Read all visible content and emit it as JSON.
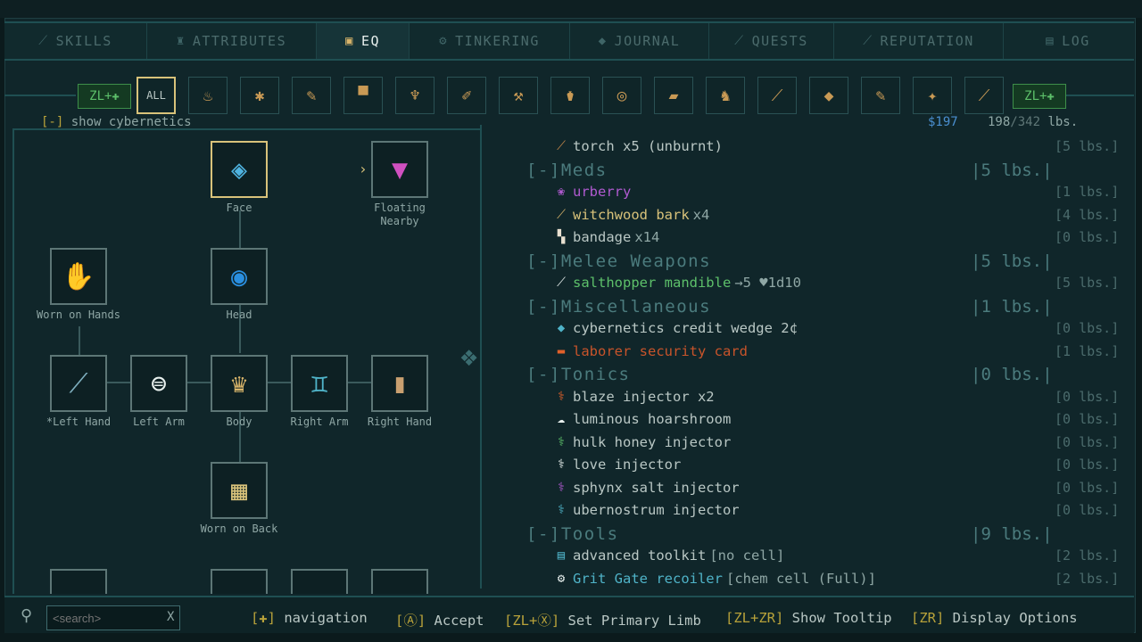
{
  "tabs": [
    {
      "label": "SKILLS",
      "icon": "skills-icon",
      "glyph": "⟋"
    },
    {
      "label": "ATTRIBUTES",
      "icon": "attributes-icon",
      "glyph": "♜"
    },
    {
      "label": "EQ",
      "icon": "eq-icon",
      "glyph": "▣"
    },
    {
      "label": "TINKERING",
      "icon": "tinkering-icon",
      "glyph": "⚙"
    },
    {
      "label": "JOURNAL",
      "icon": "journal-icon",
      "glyph": "◆"
    },
    {
      "label": "QUESTS",
      "icon": "quests-icon",
      "glyph": "⟋"
    },
    {
      "label": "REPUTATION",
      "icon": "reputation-icon",
      "glyph": "⟋"
    },
    {
      "label": "LOG",
      "icon": "log-icon",
      "glyph": "▤"
    }
  ],
  "filters": {
    "zl_left": "ZL+✚",
    "zl_right": "ZL+✚",
    "all_label": "ALL",
    "icons": [
      "♨",
      "✱",
      "✎",
      "▀",
      "♆",
      "✐",
      "⚒",
      "⚱",
      "◎",
      "▰",
      "♞",
      "⟋",
      "◆",
      "✎",
      "✦",
      "⟋"
    ]
  },
  "show_cybernetics": {
    "bracket": "[-]",
    "label": "show cybernetics"
  },
  "money": "$197",
  "weight": {
    "current": "198",
    "max": "/342",
    "unit": "lbs."
  },
  "body_slots": [
    {
      "label": "Face",
      "glyph": "◈",
      "color": "#4fb3e0"
    },
    {
      "label": "Floating Nearby",
      "glyph": "▼",
      "color": "#d050c0"
    },
    {
      "label": "Worn on Hands",
      "glyph": "✋",
      "color": "#e0602a"
    },
    {
      "label": "Head",
      "glyph": "◉",
      "color": "#2a8fe0"
    },
    {
      "label": "*Left Hand",
      "glyph": "⟋",
      "color": "#7fb0c0"
    },
    {
      "label": "Left Arm",
      "glyph": "⊜",
      "color": "#e8f0ee"
    },
    {
      "label": "Body",
      "glyph": "♛",
      "color": "#d8b46a"
    },
    {
      "label": "Right Arm",
      "glyph": "♊",
      "color": "#4fb3c8"
    },
    {
      "label": "Right Hand",
      "glyph": "▮",
      "color": "#c9a070"
    },
    {
      "label": "Worn on Back",
      "glyph": "▦",
      "color": "#d8c27a"
    }
  ],
  "inventory": {
    "top_item": {
      "text": "torch x5 (unburnt)",
      "weight": "[5 lbs.]",
      "icon": "torch-icon",
      "glyph": "⟋",
      "color": "#c98a4a"
    },
    "categories": [
      {
        "name": "Meds",
        "bracket": "[-]",
        "weight": "|5 lbs.|",
        "items": [
          {
            "name": "urberry",
            "suffix": "",
            "weight": "[1 lbs.]",
            "glyph": "❀",
            "color": "#b05ad0",
            "name_color": "#b05ad0"
          },
          {
            "name": "witchwood bark",
            "suffix": " x4",
            "weight": "[4 lbs.]",
            "glyph": "⟋",
            "color": "#d8b46a",
            "name_color": "#d8c27a"
          },
          {
            "name": "bandage",
            "suffix": " x14",
            "weight": "[0 lbs.]",
            "glyph": "▚",
            "color": "#e8e0d0",
            "name_color": "#b9c7c4"
          }
        ]
      },
      {
        "name": "Melee Weapons",
        "bracket": "[-]",
        "weight": "|5 lbs.|",
        "items": [
          {
            "name": "salthopper mandible",
            "suffix": " →5 ♥1d10",
            "weight": "[5 lbs.]",
            "glyph": "⟋",
            "color": "#e8f0ee",
            "name_color": "#5dc06a"
          }
        ]
      },
      {
        "name": "Miscellaneous",
        "bracket": "[-]",
        "weight": "|1 lbs.|",
        "items": [
          {
            "name": "cybernetics credit wedge 2¢",
            "suffix": "",
            "weight": "[0 lbs.]",
            "glyph": "◆",
            "color": "#4fb3c8",
            "name_color": "#b9c7c4"
          },
          {
            "name": "laborer security card",
            "suffix": "",
            "weight": "[1 lbs.]",
            "glyph": "▬",
            "color": "#e0602a",
            "name_color": "#c8542a"
          }
        ]
      },
      {
        "name": "Tonics",
        "bracket": "[-]",
        "weight": "|0 lbs.|",
        "items": [
          {
            "name": "blaze injector x2",
            "suffix": "",
            "weight": "[0 lbs.]",
            "glyph": "⚕",
            "color": "#e0602a",
            "name_color": "#b9c7c4"
          },
          {
            "name": "luminous hoarshroom",
            "suffix": "",
            "weight": "[0 lbs.]",
            "glyph": "☁",
            "color": "#e8f0ee",
            "name_color": "#b9c7c4"
          },
          {
            "name": "hulk honey injector",
            "suffix": "",
            "weight": "[0 lbs.]",
            "glyph": "⚕",
            "color": "#5dc06a",
            "name_color": "#b9c7c4"
          },
          {
            "name": "love injector",
            "suffix": "",
            "weight": "[0 lbs.]",
            "glyph": "⚕",
            "color": "#e8f0ee",
            "name_color": "#b9c7c4"
          },
          {
            "name": "sphynx salt injector",
            "suffix": "",
            "weight": "[0 lbs.]",
            "glyph": "⚕",
            "color": "#b05ad0",
            "name_color": "#b9c7c4"
          },
          {
            "name": "ubernostrum injector",
            "suffix": "",
            "weight": "[0 lbs.]",
            "glyph": "⚕",
            "color": "#4fb3c8",
            "name_color": "#b9c7c4"
          }
        ]
      },
      {
        "name": "Tools",
        "bracket": "[-]",
        "weight": "|9 lbs.|",
        "items": [
          {
            "name": "advanced toolkit",
            "suffix": " [no cell]",
            "weight": "[2 lbs.]",
            "glyph": "▤",
            "color": "#4fb3c8",
            "name_color": "#b9c7c4"
          },
          {
            "name": "Grit Gate recoiler",
            "suffix": " [chem cell (Full)]",
            "weight": "[2 lbs.]",
            "glyph": "⚙",
            "color": "#e8f0ee",
            "name_color": "#4fb3c8"
          }
        ]
      }
    ]
  },
  "search": {
    "placeholder": "<search>",
    "clear": "X"
  },
  "hints": [
    {
      "key": "[✚]",
      "label": " navigation"
    },
    {
      "key": "[Ⓐ]",
      "label": " Accept"
    },
    {
      "key": "[ZL+Ⓧ]",
      "label": " Set Primary Limb"
    },
    {
      "key": "[ZL+ZR]",
      "label": " Show Tooltip"
    },
    {
      "key": "[ZR]",
      "label": " Display Options"
    }
  ],
  "colors": {
    "accent": "#d8c27a",
    "green": "#5dc06a",
    "blue": "#4a8fd0",
    "panel": "#10262a"
  }
}
